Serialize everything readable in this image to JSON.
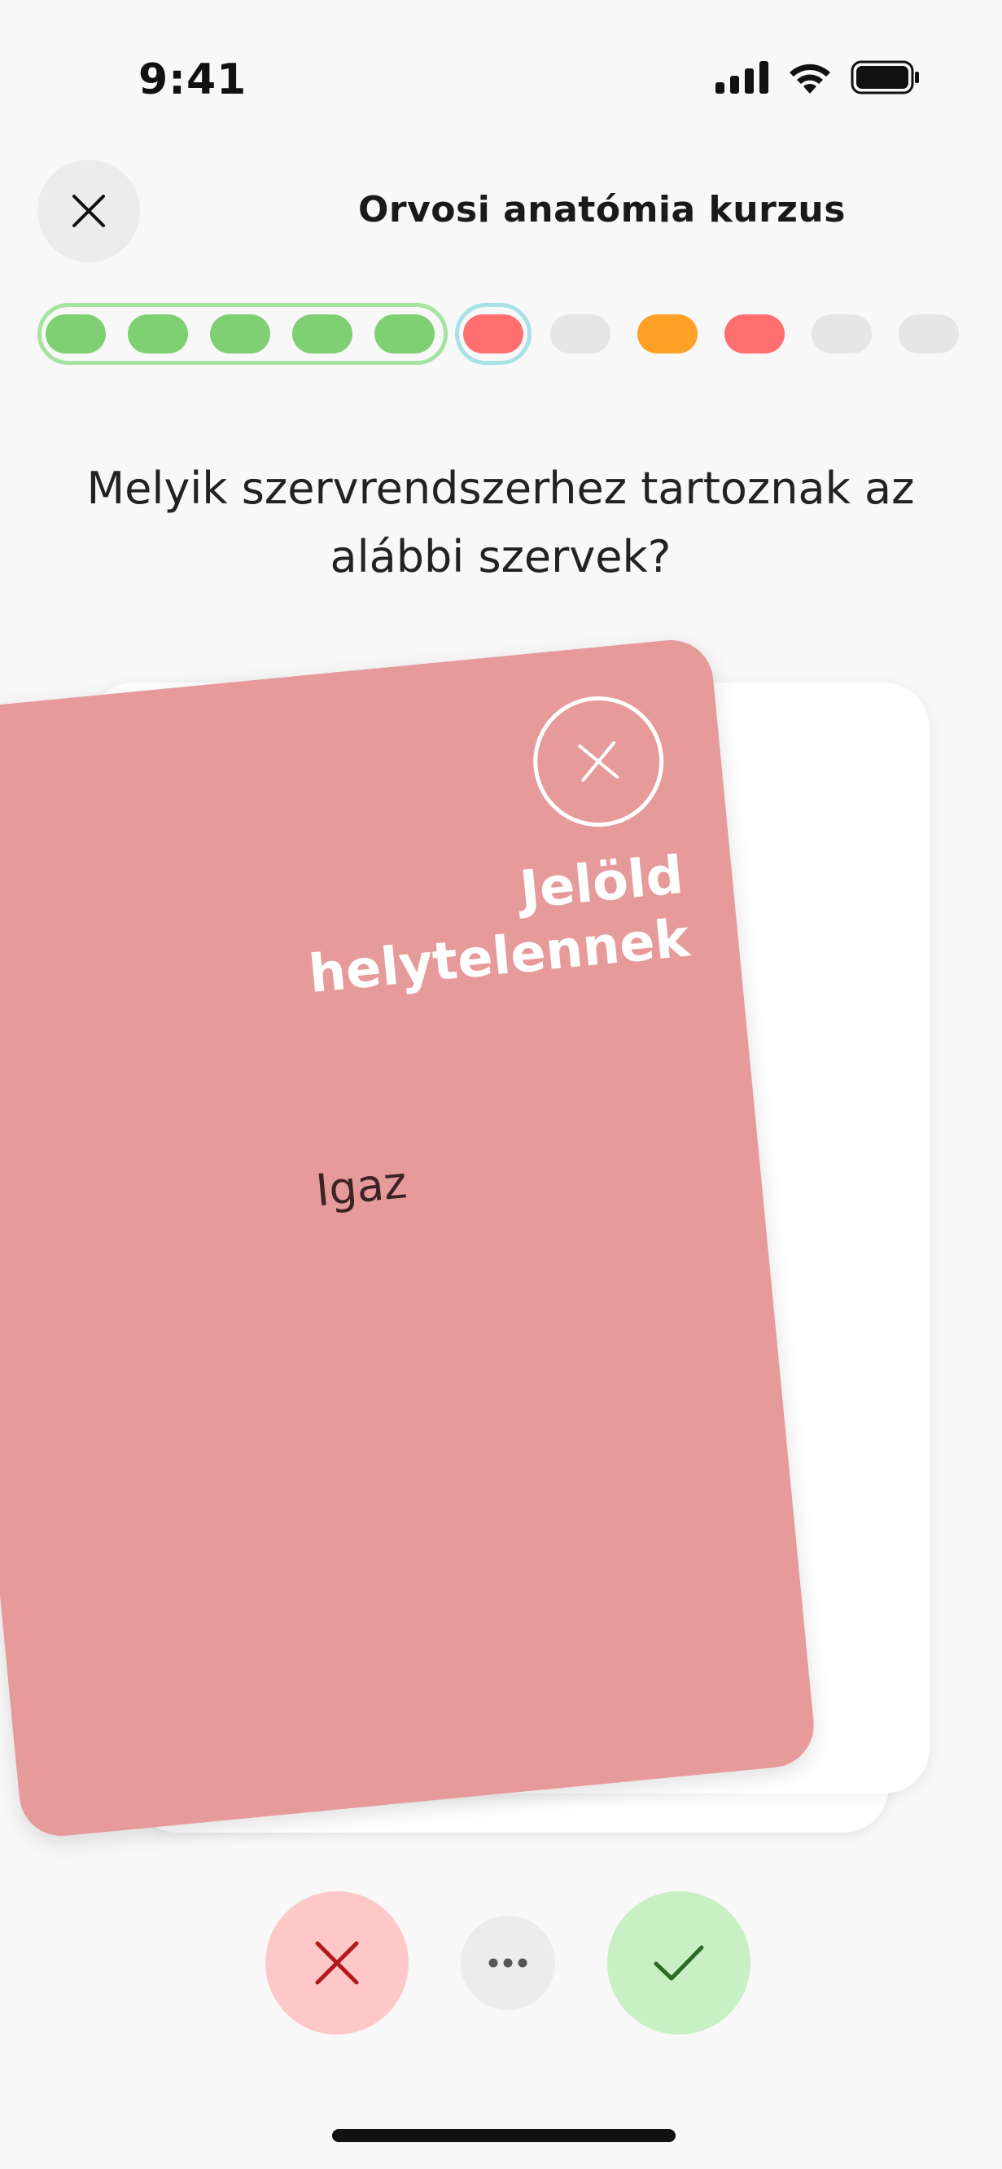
{
  "status_bar": {
    "time": "9:41",
    "icons": [
      "signal-icon",
      "wifi-icon",
      "battery-icon"
    ]
  },
  "header": {
    "title": "Orvosi anatómia kurzus",
    "close_icon": "close-icon"
  },
  "progress": {
    "steps": [
      {
        "state": "correct",
        "color": "#7fd072"
      },
      {
        "state": "correct",
        "color": "#7fd072"
      },
      {
        "state": "correct",
        "color": "#7fd072"
      },
      {
        "state": "correct",
        "color": "#7fd072"
      },
      {
        "state": "correct",
        "color": "#7fd072"
      },
      {
        "state": "wrong-current",
        "color": "#ff6f6f"
      },
      {
        "state": "pending",
        "color": "#e6e6e6"
      },
      {
        "state": "partial",
        "color": "#ffa126"
      },
      {
        "state": "wrong",
        "color": "#ff6f6f"
      },
      {
        "state": "pending",
        "color": "#e6e6e6"
      },
      {
        "state": "pending",
        "color": "#e6e6e6"
      }
    ]
  },
  "question": {
    "line1": "Melyik szervrendszerhez tartoznak az",
    "line2": "alábbi szervek?"
  },
  "card": {
    "answer": "Igaz",
    "overlay_line1": "Jelöld",
    "overlay_line2": "helytelennek",
    "overlay_icon": "close-icon",
    "background_color": "#e79a9a"
  },
  "actions": {
    "wrong_icon": "close-icon",
    "more_icon": "more-icon",
    "correct_icon": "check-icon"
  }
}
